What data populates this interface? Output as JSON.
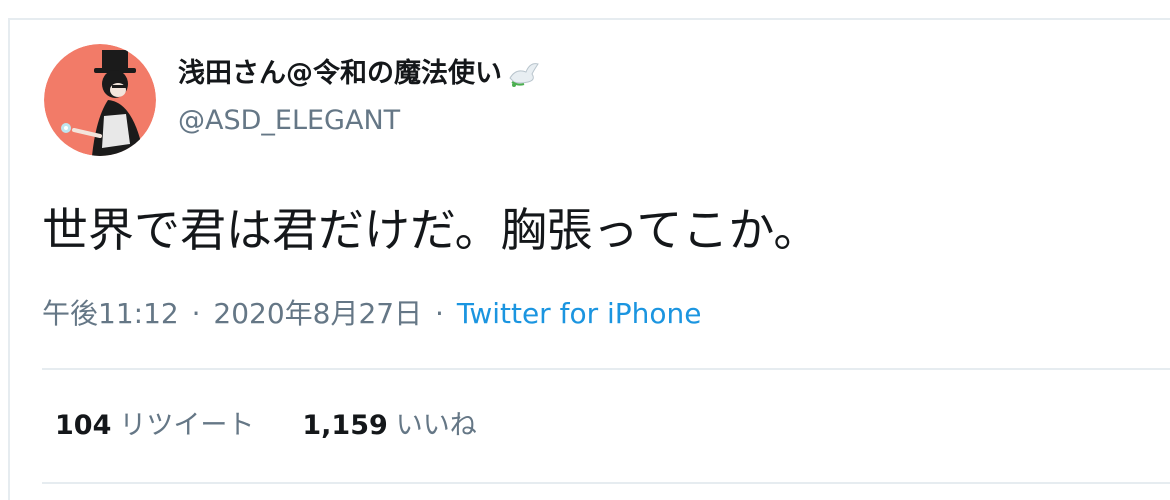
{
  "author": {
    "display_name": "浅田さん@令和の魔法使い",
    "name_emoji": "dove-icon",
    "handle": "@ASD_ELEGANT",
    "avatar": "magician-avatar"
  },
  "tweet": {
    "text": "世界で君は君だけだ。胸張ってこか。",
    "time": "午後11:12",
    "separator": "·",
    "date": "2020年8月27日",
    "source": "Twitter for iPhone"
  },
  "stats": {
    "retweet_count": "104",
    "retweet_label": "リツイート",
    "like_count": "1,159",
    "like_label": "いいね"
  },
  "colors": {
    "text_primary": "#14171a",
    "text_secondary": "#657786",
    "link": "#1b95e0",
    "border": "#e6ecf0",
    "avatar_bg": "#f27b68"
  }
}
